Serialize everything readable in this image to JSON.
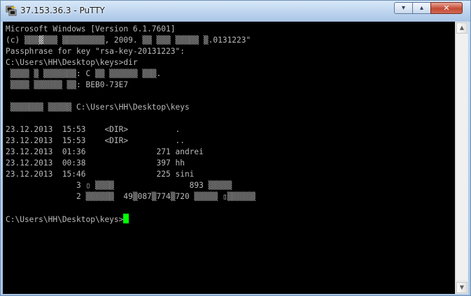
{
  "window": {
    "title": "37.153.36.3 - PuTTY",
    "controls": {
      "minimize": "▾",
      "maximize": "▴",
      "close": "✕"
    }
  },
  "colors": {
    "terminal_bg": "#000000",
    "terminal_text": "#bbbbbb",
    "cursor": "#00ff00"
  },
  "icons": {
    "app": "putty-icon",
    "scroll_up": "scroll-up-arrow-icon",
    "scroll_down": "scroll-down-arrow-icon"
  },
  "terminal": {
    "lines": [
      "Microsoft Windows [Version 6.1.7601]",
      "(c) ▒▒▒▓▒▒▒ ▒▒▒▒▒▒▒▒▒, 2009. ▒▒ ▒▒▒ ▒▒▒▒▒ ▒.0131223\"",
      "Passphrase for key \"rsa-key-20131223\":",
      "C:\\Users\\HH\\Desktop\\keys>dir",
      " ▒▒▒▒ ▒ ▒▒▒▒▒▒▒: C ▒▒ ▒▒▒▒▒▒ ▒▒▒.",
      " ▒▒▒▒ ▒▒▒▒▒▒ ▒▒: BEB0-73E7",
      "",
      " ▒▒▒▒▒▒▒ ▒▒▒▒▒ C:\\Users\\HH\\Desktop\\keys",
      "",
      "23.12.2013  15:53    <DIR>          .",
      "23.12.2013  15:53    <DIR>          ..",
      "23.12.2013  01:36               271 andrei",
      "23.12.2013  00:38               397 hh",
      "23.12.2013  15:46               225 sini",
      "               3 ▯ ▒▒▒▒                893 ▒▒▒▒▒",
      "               2 ▒▒▒▒▒▒  49▒087▒774▒720 ▒▒▒▒▒ ▯▒▒▒▒▒▒",
      "",
      "C:\\Users\\HH\\Desktop\\keys>"
    ]
  }
}
